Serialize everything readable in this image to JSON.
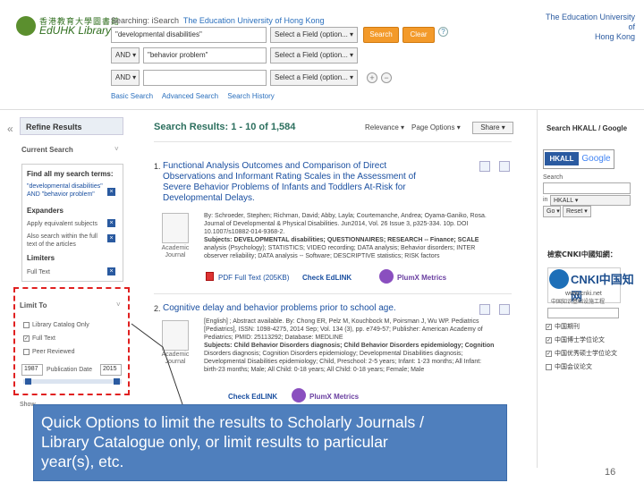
{
  "header": {
    "logo_cn": "香港教育大學圖書館",
    "logo_en": "EdUHK Library",
    "searching_label": "Searching: iSearch",
    "searching_inst": "The Education University of Hong Kong",
    "institution_line1": "The Education University of",
    "institution_line2": "Hong Kong"
  },
  "search": {
    "row1_value": "\"developmental disabilities\"",
    "row1_field": "Select a Field (option...",
    "search_label": "Search",
    "clear_label": "Clear",
    "row2_bool": "AND",
    "row2_value": "\"behavior problem\"",
    "row2_field": "Select a Field (option...",
    "row3_bool": "AND",
    "row3_value": "",
    "row3_field": "Select a Field (option...",
    "basic_search": "Basic Search",
    "advanced_search": "Advanced Search",
    "search_history": "Search History"
  },
  "left_panel": {
    "title": "Refine Results",
    "current_search": "Current Search",
    "find_all": "Find all my search terms:",
    "terms_line1": "\"developmental disabilities\"",
    "terms_line2": "AND \"behavior problem\"",
    "expanders": "Expanders",
    "exp1": "Apply equivalent subjects",
    "exp2_line1": "Also search within the full",
    "exp2_line2": "text of the articles",
    "limiters": "Limiters",
    "lim1": "Full Text",
    "limit_to": "Limit To",
    "opt1": "Library Catalog Only",
    "opt2": "Full Text",
    "opt3": "Peer Reviewed",
    "year_from": "1987",
    "pub_date_label": "Publication Date",
    "year_to": "2015",
    "show_more": "Show"
  },
  "results": {
    "title_label": "Search Results:",
    "title_range": "1 - 10 of 1,584",
    "relevance": "Relevance",
    "page_options": "Page Options",
    "share": "Share",
    "r1": {
      "num": "1.",
      "title_line1": "Functional Analysis Outcomes and Comparison of Direct",
      "title_line2": "Observations and Informant Rating Scales in the Assessment of",
      "title_line3": "Severe Behavior Problems of Infants and Toddlers At-Risk for",
      "title_line4": "Developmental Delays.",
      "meta_line1": "By: Schroeder, Stephen; Richman, David; Abby, Layla; Courtemanche, Andrea; Oyama-Ganiko, Rosa.",
      "meta_line2": "Journal of Developmental & Physical Disabilities. Jun2014, Vol. 26 Issue 3, p325-334. 10p. DOI",
      "meta_line3": "10.1007/s10882-014-9368-2.",
      "meta_line4": "Subjects: DEVELOPMENTAL disabilities; QUESTIONNAIRES; RESEARCH -- Finance; SCALE",
      "meta_line5": "analysis (Psychology); STATISTICS; VIDEO recording; DATA analysis; Behavior disorders; INTER",
      "meta_line6": "observer reliability; DATA analysis -- Software; DESCRIPTIVE statistics; RISK factors",
      "type_line1": "Academic",
      "type_line2": "Journal",
      "pdf": "PDF Full Text (205KB)",
      "check": "Check EdLINK",
      "metrics": "PlumX Metrics"
    },
    "r2": {
      "num": "2.",
      "title": "Cognitive delay and behavior problems prior to school age.",
      "meta_line1": "[English] ; Abstract available. By: Chong ER, Pelz M, Kouchbock M, Poirsman J, Wu WP. Pediatrics",
      "meta_line2": "[Pediatrics], ISSN: 1098-4275, 2014 Sep; Vol. 134 (3), pp. e749-57; Publisher: American Academy of",
      "meta_line3": "Pediatrics; PMID: 25113292; Database: MEDLINE",
      "meta_line4": "Subjects: Child Behavior Disorders diagnosis; Child Behavior Disorders epidemiology; Cognition",
      "meta_line5": "Disorders diagnosis; Cognition Disorders epidemiology; Developmental Disabilities diagnosis;",
      "meta_line6": "Developmental Disabilities epidemiology; Child, Preschool: 2-5 years; Infant: 1-23 months; All Infant:",
      "meta_line7": "birth-23 months; Male; All Child: 0-18 years; All Child: 0-18 years; Female; Male",
      "type_line1": "Academic",
      "type_line2": "Journal",
      "check": "Check EdLINK",
      "metrics": "PlumX Metrics"
    }
  },
  "right_panel": {
    "head": "Search HKALL / Google",
    "hkall": "HKALL",
    "google": "Google",
    "search_label": "Search",
    "in_label": "in",
    "in_value": "HKALL",
    "go": "Go",
    "reset": "Reset",
    "cnki_head": "檢索CNKI中國知網：",
    "cnki_logo": "CNKI中国知网",
    "cnki_url": "www.cnki.net",
    "cnki_sub": "中国知识基础设施工程",
    "opt1": "中国期刊",
    "opt2": "中国博士学位论文",
    "opt3": "中国优秀硕士学位论文",
    "opt4": "中国会议论文"
  },
  "callout": {
    "line1": "Quick Options to limit the results to Scholarly Journals /",
    "line2": "Library Catalogue only, or limit results to particular",
    "line3": "year(s), etc."
  },
  "page_number": "16"
}
